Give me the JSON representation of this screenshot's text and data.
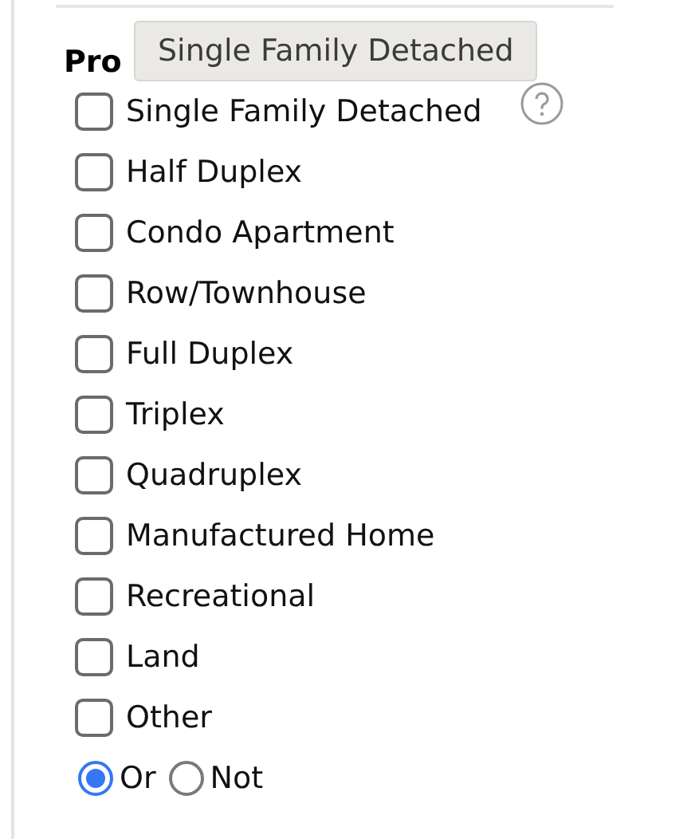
{
  "section": {
    "title": "Pro"
  },
  "tooltip": {
    "text": "Single Family Detached"
  },
  "options": [
    {
      "label": "Single Family Detached",
      "checked": false,
      "help": true
    },
    {
      "label": "Half Duplex",
      "checked": false
    },
    {
      "label": "Condo Apartment",
      "checked": false
    },
    {
      "label": "Row/Townhouse",
      "checked": false
    },
    {
      "label": "Full Duplex",
      "checked": false
    },
    {
      "label": "Triplex",
      "checked": false
    },
    {
      "label": "Quadruplex",
      "checked": false
    },
    {
      "label": "Manufactured Home",
      "checked": false
    },
    {
      "label": "Recreational",
      "checked": false
    },
    {
      "label": "Land",
      "checked": false
    },
    {
      "label": "Other",
      "checked": false
    }
  ],
  "mode": [
    {
      "label": "Or",
      "selected": true
    },
    {
      "label": "Not",
      "selected": false
    }
  ]
}
